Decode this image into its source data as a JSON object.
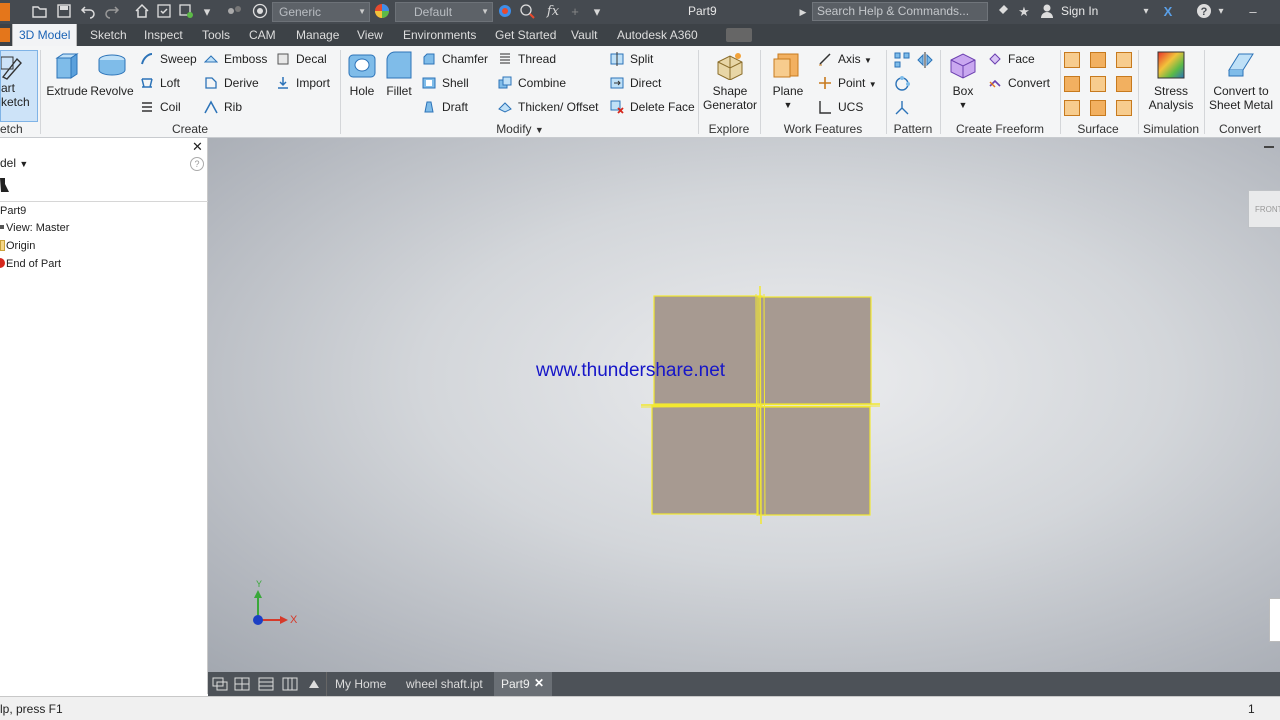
{
  "title_bar": {
    "style_combo": "Generic",
    "appearance_combo": "Default",
    "doc_title": "Part9",
    "search_placeholder": "Search Help & Commands...",
    "sign_in": "Sign In",
    "fx_label": "fx"
  },
  "menu": {
    "tabs": [
      "3D Model",
      "Sketch",
      "Inspect",
      "Tools",
      "CAM",
      "Manage",
      "View",
      "Environments",
      "Get Started",
      "Vault",
      "Autodesk A360"
    ]
  },
  "ribbon": {
    "sketch": {
      "start_line1": "art",
      "start_line2": "ketch",
      "group": "etch"
    },
    "create": {
      "extrude": "Extrude",
      "revolve": "Revolve",
      "sweep": "Sweep",
      "loft": "Loft",
      "coil": "Coil",
      "emboss": "Emboss",
      "derive": "Derive",
      "rib": "Rib",
      "decal": "Decal",
      "import": "Import",
      "group": "Create"
    },
    "modify": {
      "hole": "Hole",
      "fillet": "Fillet",
      "chamfer": "Chamfer",
      "shell": "Shell",
      "draft": "Draft",
      "thread": "Thread",
      "combine": "Combine",
      "thicken": "Thicken/ Offset",
      "split": "Split",
      "direct": "Direct",
      "delete_face": "Delete Face",
      "group": "Modify"
    },
    "explore": {
      "shape_gen_1": "Shape",
      "shape_gen_2": "Generator",
      "group": "Explore"
    },
    "work_features": {
      "plane": "Plane",
      "axis": "Axis",
      "point": "Point",
      "ucs": "UCS",
      "group": "Work Features"
    },
    "pattern": {
      "group": "Pattern"
    },
    "freeform": {
      "box": "Box",
      "face": "Face",
      "convert": "Convert",
      "group": "Create Freeform"
    },
    "surface": {
      "group": "Surface"
    },
    "simulation": {
      "stress_1": "Stress",
      "stress_2": "Analysis",
      "group": "Simulation"
    },
    "convert": {
      "sheet_1": "Convert to",
      "sheet_2": "Sheet Metal",
      "group": "Convert"
    }
  },
  "browser": {
    "header": "del",
    "items": [
      "Part9",
      "View: Master",
      "Origin",
      "End of Part"
    ]
  },
  "viewport": {
    "watermark": "www.thundershare.net",
    "viewcube_label": "FRONT",
    "axis_x": "X",
    "axis_y": "Y",
    "sketch_color": "#f2e830"
  },
  "doc_tabs": {
    "items": [
      "My Home",
      "wheel shaft.ipt",
      "Part9"
    ]
  },
  "status": {
    "left": "lp, press F1",
    "right": "1"
  }
}
